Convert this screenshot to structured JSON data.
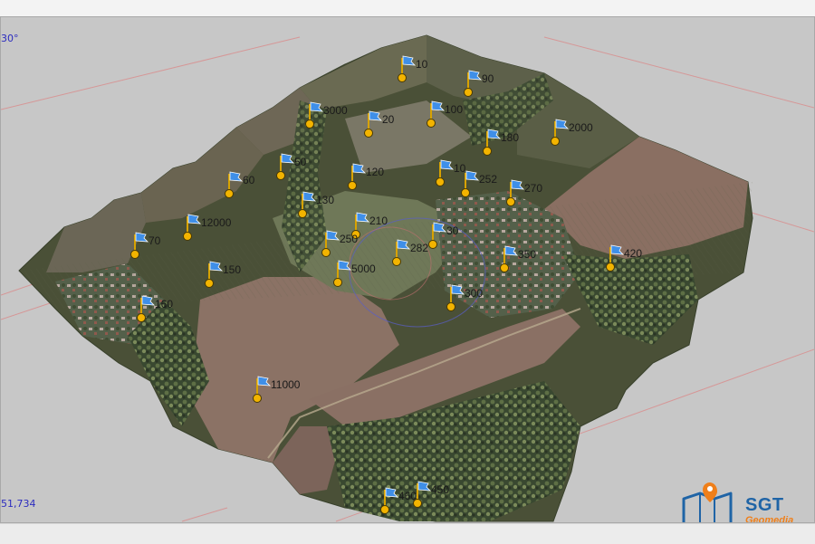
{
  "viewport": {
    "angle_readout": "30°",
    "coordinate_readout": "51,734"
  },
  "markers": [
    {
      "label": "10"
    },
    {
      "label": "90"
    },
    {
      "label": "3000"
    },
    {
      "label": "20"
    },
    {
      "label": "100"
    },
    {
      "label": "180"
    },
    {
      "label": "2000"
    },
    {
      "label": "60"
    },
    {
      "label": "50"
    },
    {
      "label": "120"
    },
    {
      "label": "10"
    },
    {
      "label": "252"
    },
    {
      "label": "270"
    },
    {
      "label": "130"
    },
    {
      "label": "12000"
    },
    {
      "label": "210"
    },
    {
      "label": "30"
    },
    {
      "label": "70"
    },
    {
      "label": "250"
    },
    {
      "label": "282"
    },
    {
      "label": "350"
    },
    {
      "label": "420"
    },
    {
      "label": "150"
    },
    {
      "label": "5000"
    },
    {
      "label": "300"
    },
    {
      "label": "160"
    },
    {
      "label": "11000"
    },
    {
      "label": "460"
    },
    {
      "label": "450"
    }
  ],
  "logo": {
    "brand": "SGT",
    "subtitle": "Geomedia"
  },
  "colors": {
    "marker_pin": "#f3b400",
    "marker_flag": "#3f8fe8",
    "hud_text": "#2c2cbf",
    "brand_blue": "#1f64a6",
    "brand_orange": "#ef7f1a"
  }
}
